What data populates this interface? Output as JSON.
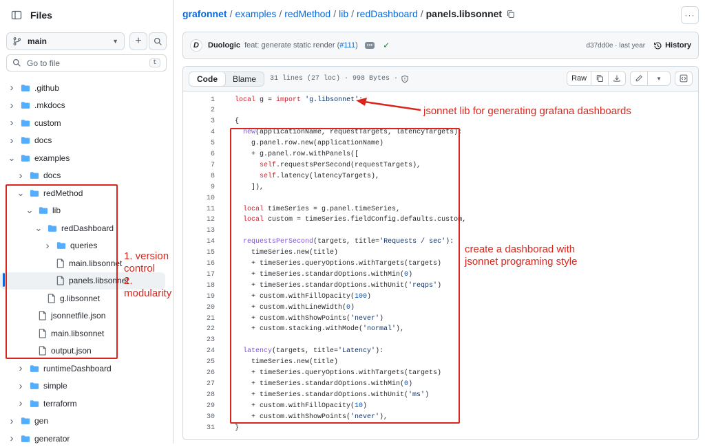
{
  "sidebar": {
    "title": "Files",
    "branch": "main",
    "goto_placeholder": "Go to file",
    "goto_shortcut": "t",
    "tree": [
      {
        "label": ".github",
        "type": "folder",
        "expanded": false
      },
      {
        "label": ".mkdocs",
        "type": "folder",
        "expanded": false
      },
      {
        "label": "custom",
        "type": "folder",
        "expanded": false
      },
      {
        "label": "docs",
        "type": "folder",
        "expanded": false
      },
      {
        "label": "examples",
        "type": "folder",
        "expanded": true
      },
      {
        "label": "docs",
        "type": "folder",
        "expanded": false
      },
      {
        "label": "redMethod",
        "type": "folder",
        "expanded": true
      },
      {
        "label": "lib",
        "type": "folder",
        "expanded": true
      },
      {
        "label": "redDashboard",
        "type": "folder",
        "expanded": true
      },
      {
        "label": "queries",
        "type": "folder",
        "expanded": false
      },
      {
        "label": "main.libsonnet",
        "type": "file"
      },
      {
        "label": "panels.libsonnet",
        "type": "file",
        "selected": true
      },
      {
        "label": "g.libsonnet",
        "type": "file"
      },
      {
        "label": "jsonnetfile.json",
        "type": "file"
      },
      {
        "label": "main.libsonnet",
        "type": "file"
      },
      {
        "label": "output.json",
        "type": "file"
      },
      {
        "label": "runtimeDashboard",
        "type": "folder",
        "expanded": false
      },
      {
        "label": "simple",
        "type": "folder",
        "expanded": false
      },
      {
        "label": "terraform",
        "type": "folder",
        "expanded": false
      },
      {
        "label": "gen",
        "type": "folder",
        "expanded": false
      },
      {
        "label": "generator",
        "type": "folder",
        "expanded": false
      }
    ]
  },
  "breadcrumb": {
    "parts": [
      "grafonnet",
      "examples",
      "redMethod",
      "lib",
      "redDashboard"
    ],
    "current": "panels.libsonnet"
  },
  "commit": {
    "author": "Duologic",
    "message_prefix": "feat: generate static render (",
    "pr": "#111",
    "message_suffix": ")",
    "ellipsis": "•••",
    "sha_time": "d37dd0e · last year",
    "history_label": "History"
  },
  "viewer": {
    "tab_code": "Code",
    "tab_blame": "Blame",
    "meta": "31 lines (27 loc) · 998 Bytes ·",
    "raw_label": "Raw"
  },
  "code_lines": [
    "local g = import 'g.libsonnet';",
    "",
    "{",
    "  new(applicationName, requestTargets, latencyTargets):",
    "    g.panel.row.new(applicationName)",
    "    + g.panel.row.withPanels([",
    "      self.requestsPerSecond(requestTargets),",
    "      self.latency(latencyTargets),",
    "    ]),",
    "",
    "  local timeSeries = g.panel.timeSeries,",
    "  local custom = timeSeries.fieldConfig.defaults.custom,",
    "",
    "  requestsPerSecond(targets, title='Requests / sec'):",
    "    timeSeries.new(title)",
    "    + timeSeries.queryOptions.withTargets(targets)",
    "    + timeSeries.standardOptions.withMin(0)",
    "    + timeSeries.standardOptions.withUnit('reqps')",
    "    + custom.withFillOpacity(100)",
    "    + custom.withLineWidth(0)",
    "    + custom.withShowPoints('never')",
    "    + custom.stacking.withMode('normal'),",
    "",
    "  latency(targets, title='Latency'):",
    "    timeSeries.new(title)",
    "    + timeSeries.queryOptions.withTargets(targets)",
    "    + timeSeries.standardOptions.withMin(0)",
    "    + timeSeries.standardOptions.withUnit('ms')",
    "    + custom.withFillOpacity(10)",
    "    + custom.withShowPoints('never'),",
    "}"
  ],
  "annotations": {
    "lib_note": "jsonnet lib for generating grafana dashboards",
    "vc_line1": "1. version control",
    "vc_line2": "2. modularity",
    "style_line1": "create a dashborad with",
    "style_line2": "jsonnet programing style",
    "color": "#d9261c"
  },
  "colors": {
    "link": "#0969da",
    "keyword": "#cf222e",
    "string": "#0a3069",
    "function": "#8250df",
    "number": "#0550ae"
  }
}
